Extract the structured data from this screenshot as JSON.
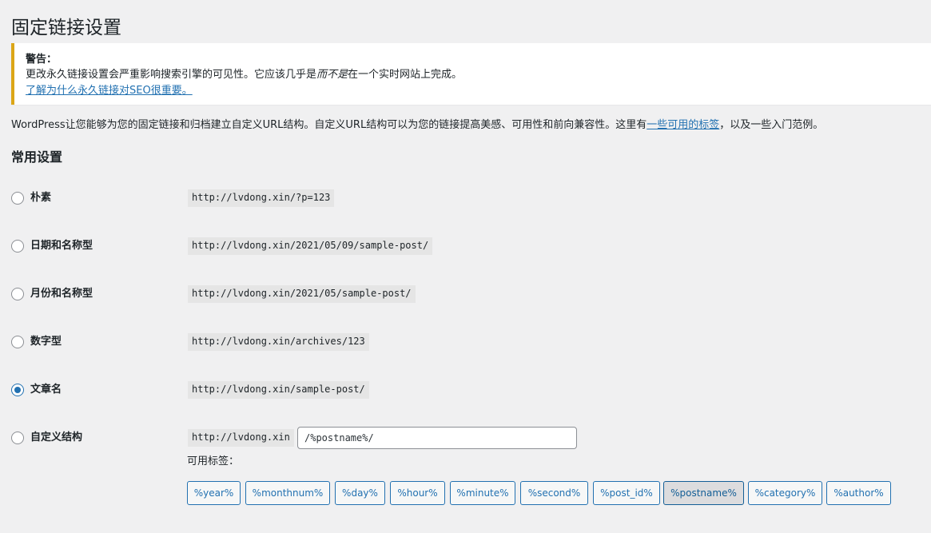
{
  "page": {
    "title": "固定链接设置"
  },
  "notice": {
    "title": "警告：",
    "line1_before": "更改永久链接设置会严重影响搜索引擎的可见性。它应该几乎是",
    "line1_emphasis": "而不是",
    "line1_after": "在一个实时网站上完成。",
    "link": "了解为什么永久链接对SEO很重要。"
  },
  "intro": {
    "before": "WordPress让您能够为您的固定链接和归档建立自定义URL结构。自定义URL结构可以为您的链接提高美感、可用性和前向兼容性。这里有",
    "link": "一些可用的标签",
    "after": "，以及一些入门范例。"
  },
  "section": {
    "title": "常用设置"
  },
  "options": [
    {
      "label": "朴素",
      "example": "http://lvdong.xin/?p=123",
      "checked": false
    },
    {
      "label": "日期和名称型",
      "example": "http://lvdong.xin/2021/05/09/sample-post/",
      "checked": false
    },
    {
      "label": "月份和名称型",
      "example": "http://lvdong.xin/2021/05/sample-post/",
      "checked": false
    },
    {
      "label": "数字型",
      "example": "http://lvdong.xin/archives/123",
      "checked": false
    },
    {
      "label": "文章名",
      "example": "http://lvdong.xin/sample-post/",
      "checked": true
    },
    {
      "label": "自定义结构",
      "example": "http://lvdong.xin",
      "checked": false
    }
  ],
  "custom": {
    "value": "/%postname%/",
    "tags_label": "可用标签：",
    "tags": [
      "%year%",
      "%monthnum%",
      "%day%",
      "%hour%",
      "%minute%",
      "%second%",
      "%post_id%",
      "%postname%",
      "%category%",
      "%author%"
    ],
    "active_tag": "%postname%"
  },
  "colors": {
    "accent": "#2271b1",
    "warning_border": "#dba617",
    "background": "#f0f0f1"
  }
}
